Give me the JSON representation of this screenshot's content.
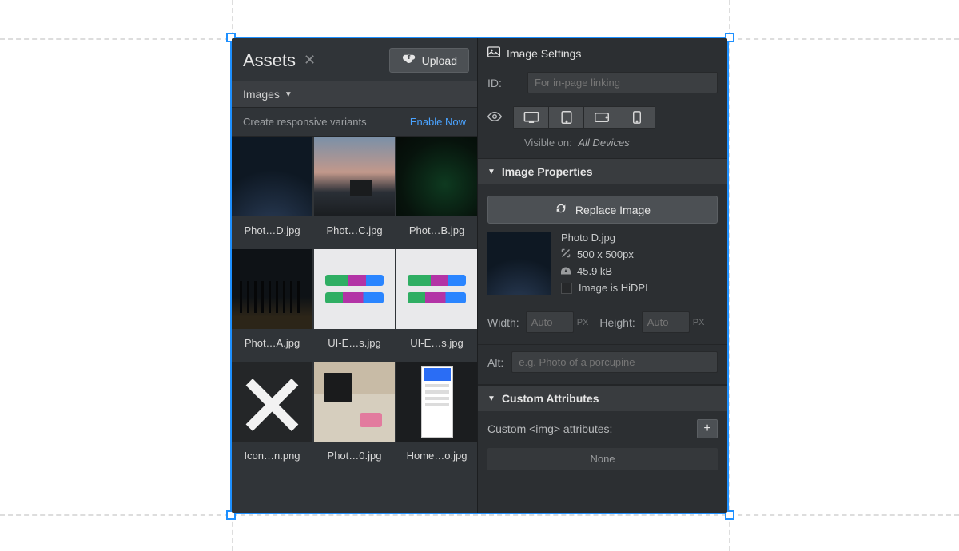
{
  "assets_panel": {
    "title": "Assets",
    "upload_label": "Upload",
    "filter_label": "Images",
    "variants_text": "Create responsive variants",
    "enable_label": "Enable Now",
    "items": [
      {
        "name": "Phot…D.jpg"
      },
      {
        "name": "Phot…C.jpg"
      },
      {
        "name": "Phot…B.jpg"
      },
      {
        "name": "Phot…A.jpg"
      },
      {
        "name": "UI-E…s.jpg"
      },
      {
        "name": "UI-E…s.jpg"
      },
      {
        "name": "Icon…n.png"
      },
      {
        "name": "Phot…0.jpg"
      },
      {
        "name": "Home…o.jpg"
      }
    ]
  },
  "settings_panel": {
    "header": "Image Settings",
    "id_label": "ID:",
    "id_placeholder": "For in-page linking",
    "visible_label": "Visible on:",
    "visible_value": "All Devices",
    "properties": {
      "header": "Image Properties",
      "replace_label": "Replace Image",
      "filename": "Photo D.jpg",
      "dimensions": "500 x 500px",
      "filesize": "45.9 kB",
      "hidpi_label": "Image is HiDPI",
      "width_label": "Width:",
      "width_placeholder": "Auto",
      "width_unit": "PX",
      "height_label": "Height:",
      "height_placeholder": "Auto",
      "height_unit": "PX",
      "alt_label": "Alt:",
      "alt_placeholder": "e.g. Photo of a porcupine"
    },
    "custom": {
      "header": "Custom Attributes",
      "label": "Custom <img> attributes:",
      "none_label": "None"
    }
  }
}
